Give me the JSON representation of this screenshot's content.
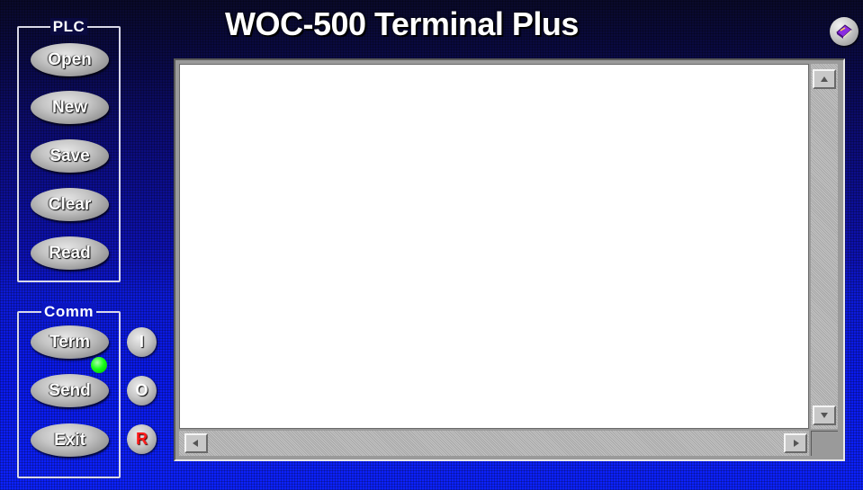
{
  "header": {
    "title": "WOC-500 Terminal Plus",
    "help_icon": "book-icon"
  },
  "plc_group": {
    "label": "PLC",
    "buttons": [
      "Open",
      "New",
      "Save",
      "Clear",
      "Read"
    ]
  },
  "comm_group": {
    "label": "Comm",
    "buttons": [
      "Term",
      "Send",
      "Exit"
    ]
  },
  "indicators": {
    "input": "I",
    "output": "O",
    "reset": "R",
    "term_led_color": "#19ff19",
    "reset_color": "#ff1a1a"
  },
  "terminal": {
    "text": "",
    "scrollbar_icons": [
      "arrow-up-icon",
      "arrow-down-icon",
      "arrow-left-icon",
      "arrow-right-icon"
    ]
  }
}
